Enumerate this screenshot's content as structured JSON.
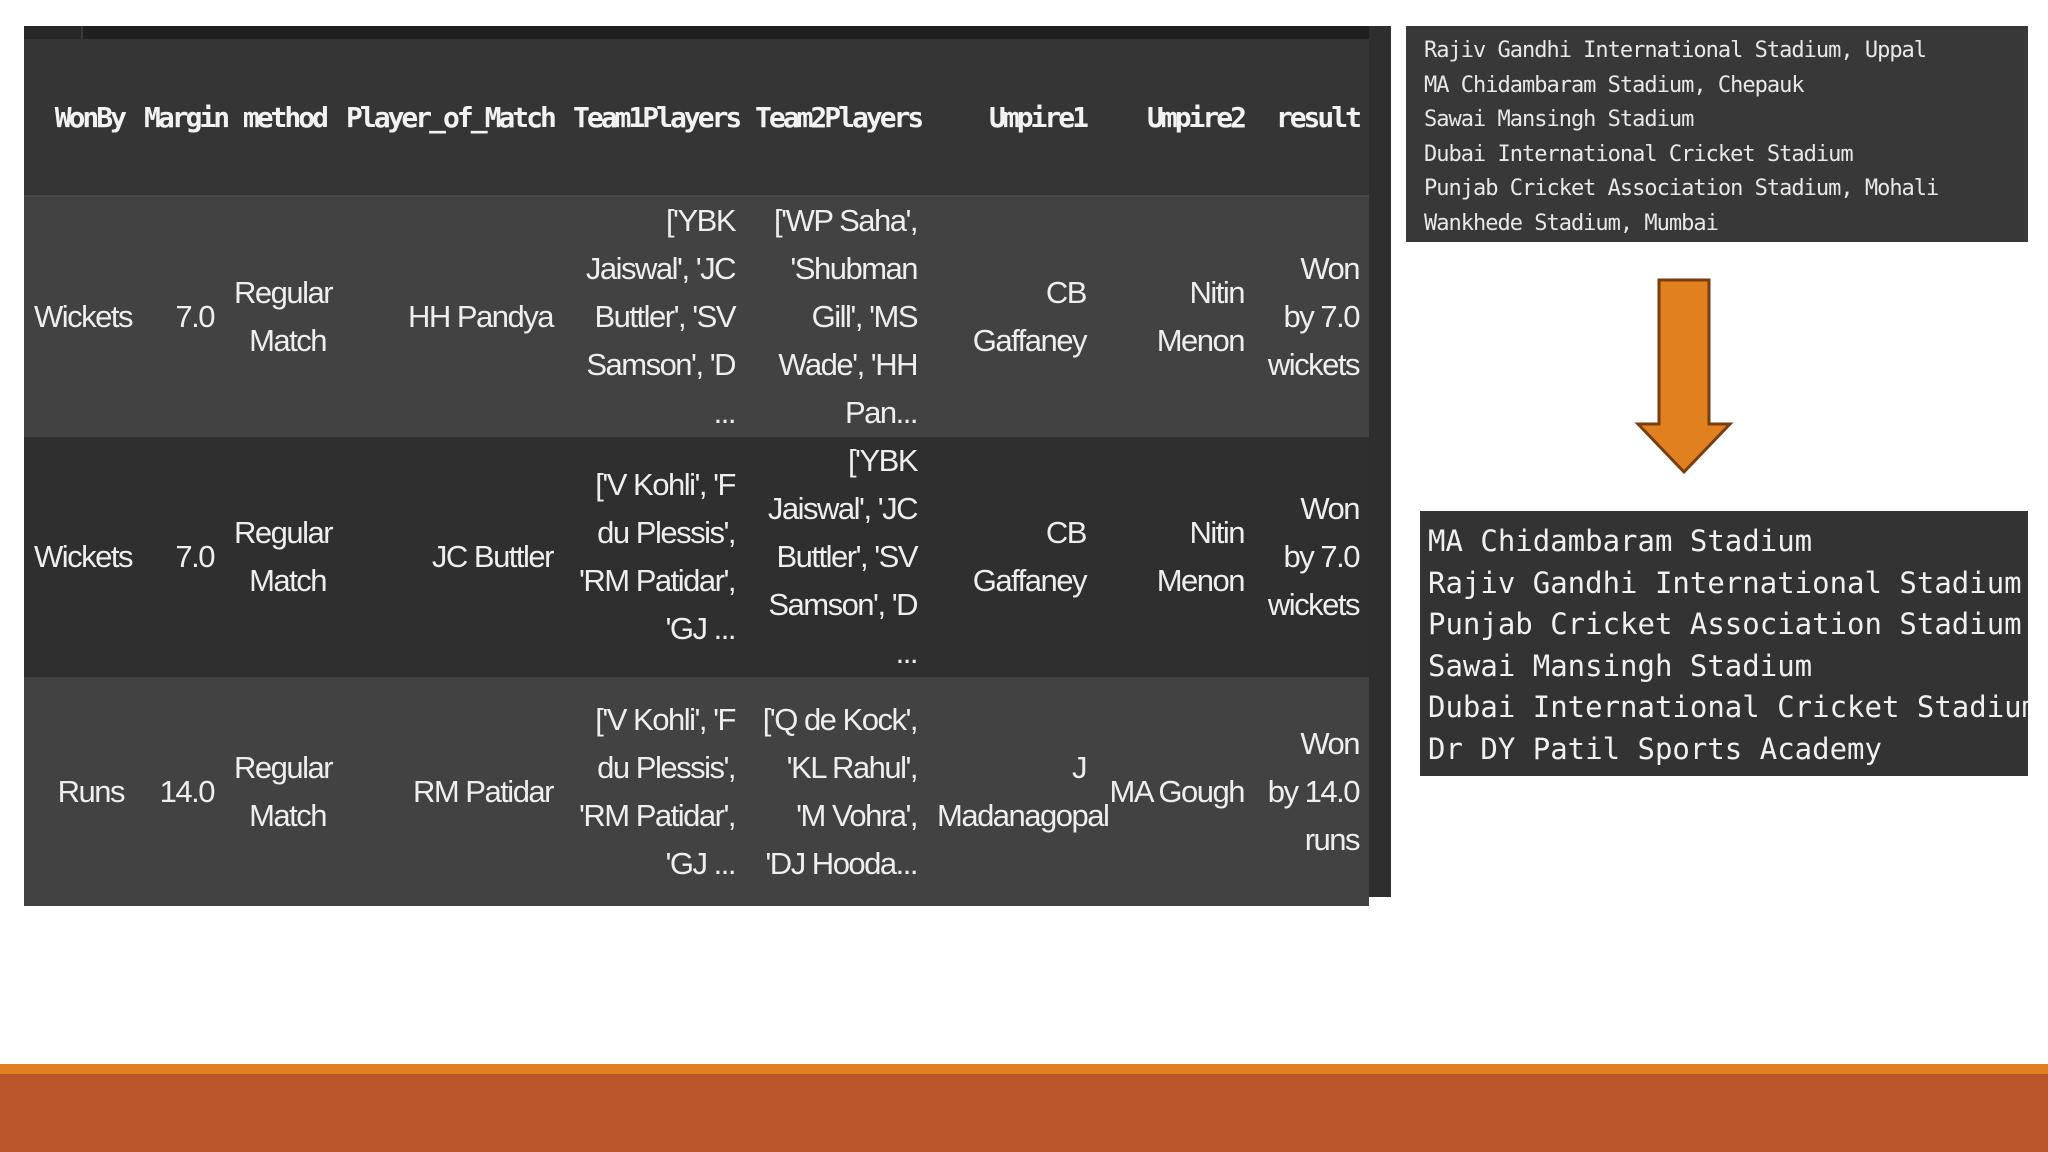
{
  "table": {
    "columns": [
      "WonBy",
      "Margin",
      "method",
      "Player_of_Match",
      "Team1Players",
      "Team2Players",
      "Umpire1",
      "Umpire2",
      "result"
    ],
    "rows": [
      {
        "WonBy": "Wickets",
        "Margin": "7.0",
        "method": "Regular Match",
        "Player_of_Match": "HH Pandya",
        "Team1Players": "['YBK Jaiswal', 'JC Buttler', 'SV Samson', 'D ...",
        "Team2Players": "['WP Saha', 'Shubman Gill', 'MS Wade', 'HH Pan...",
        "Umpire1": "CB Gaffaney",
        "Umpire2": "Nitin Menon",
        "result": "Won by 7.0 wickets"
      },
      {
        "WonBy": "Wickets",
        "Margin": "7.0",
        "method": "Regular Match",
        "Player_of_Match": "JC Buttler",
        "Team1Players": "['V Kohli', 'F du Plessis', 'RM Patidar', 'GJ ...",
        "Team2Players": "['YBK Jaiswal', 'JC Buttler', 'SV Samson', 'D ...",
        "Umpire1": "CB Gaffaney",
        "Umpire2": "Nitin Menon",
        "result": "Won by 7.0 wickets"
      },
      {
        "WonBy": "Runs",
        "Margin": "14.0",
        "method": "Regular Match",
        "Player_of_Match": "RM Patidar",
        "Team1Players": "['V Kohli', 'F du Plessis', 'RM Patidar', 'GJ ...",
        "Team2Players": "['Q de Kock', 'KL Rahul', 'M Vohra', 'DJ Hooda...",
        "Umpire1": "J Madanagopal",
        "Umpire2": "MA Gough",
        "result": "Won by 14.0 runs"
      }
    ]
  },
  "venues_before": [
    "Rajiv Gandhi International Stadium, Uppal",
    "MA Chidambaram Stadium, Chepauk",
    "Sawai Mansingh Stadium",
    "Dubai International Cricket Stadium",
    "Punjab Cricket Association Stadium, Mohali",
    "Wankhede Stadium, Mumbai"
  ],
  "venues_after": [
    "MA Chidambaram Stadium",
    "Rajiv Gandhi International Stadium",
    "Punjab Cricket Association Stadium",
    "Sawai Mansingh Stadium",
    "Dubai International Cricket Stadium",
    "Dr DY Patil Sports Academy"
  ],
  "icons": {
    "arrow": "arrow-down-icon"
  },
  "colors": {
    "arrow_fill": "#e0801e",
    "arrow_stroke": "#7a3d10",
    "footer_accent": "#e0801e",
    "footer_bar": "#b9552b"
  }
}
